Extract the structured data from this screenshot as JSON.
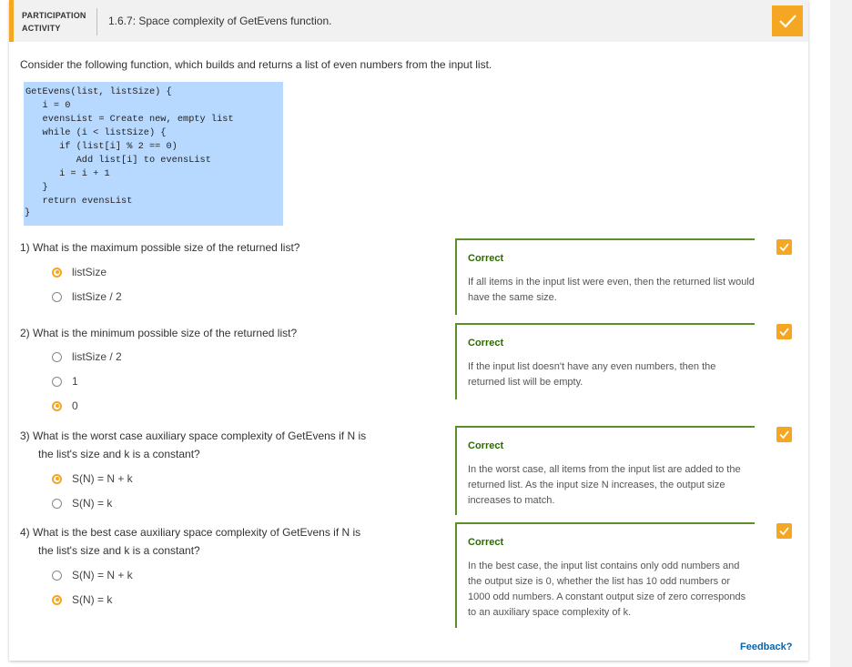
{
  "activity": {
    "label_line1": "PARTICIPATION",
    "label_line2": "ACTIVITY",
    "title": "1.6.7: Space complexity of GetEvens function.",
    "accent_color": "#f5a623",
    "completed": true
  },
  "intro": "Consider the following function, which builds and returns a list of even numbers from the input list.",
  "code": {
    "lines": "GetEvens(list, listSize) {\n   i = 0\n   evensList = Create new, empty list\n   while (i < listSize) {\n      if (list[i] % 2 == 0)\n         Add list[i] to evensList\n      i = i + 1\n   }\n   return evensList",
    "closing": "}",
    "background": "#b7d9ff"
  },
  "questions": [
    {
      "text": "1) What is the maximum possible size of the returned list?",
      "options": [
        "listSize",
        "listSize / 2"
      ],
      "selected": 0,
      "feedback_title": "Correct",
      "feedback_text": "If all items in the input list were even, then the returned list would have the same size."
    },
    {
      "text": "2) What is the minimum possible size of the returned list?",
      "options": [
        "listSize / 2",
        "1",
        "0"
      ],
      "selected": 2,
      "feedback_title": "Correct",
      "feedback_text": "If the input list doesn't have any even numbers, then the returned list will be empty."
    },
    {
      "text_line1": "3) What is the worst case auxiliary space complexity of GetEvens if N is",
      "text_line2": "the list's size and k is a constant?",
      "options": [
        "S(N) = N + k",
        "S(N) = k"
      ],
      "selected": 0,
      "feedback_title": "Correct",
      "feedback_text": "In the worst case, all items from the input list are added to the returned list. As the input size N increases, the output size increases to match."
    },
    {
      "text_line1": "4) What is the best case auxiliary space complexity of GetEvens if N is",
      "text_line2": "the list's size and k is a constant?",
      "options": [
        "S(N) = N + k",
        "S(N) = k"
      ],
      "selected": 1,
      "feedback_title": "Correct",
      "feedback_text": "In the best case, the input list contains only odd numbers and the output size is 0, whether the list has 10 odd numbers or 1000 odd numbers. A constant output size of zero corresponds to an auxiliary space complexity of k."
    }
  ],
  "feedback_link": "Feedback?"
}
